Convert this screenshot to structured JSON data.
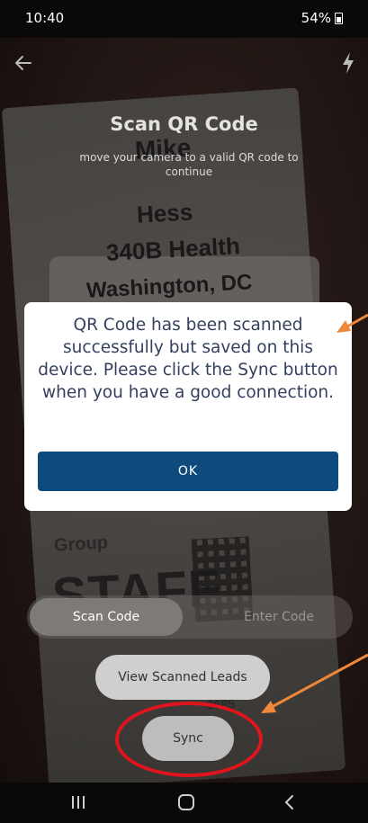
{
  "status_bar": {
    "time": "10:40",
    "battery": "54%"
  },
  "screen": {
    "title": "Scan QR Code",
    "subtitle": "move your camera to a valid QR code to continue"
  },
  "badge_photo": {
    "name": "Mike",
    "last_name": "Hess",
    "organization": "340B Health",
    "city": "Washington, DC",
    "group_label": "Group",
    "role": "STAFF",
    "code": "0685"
  },
  "dialog": {
    "message": "QR Code has been scanned successfully but saved on this device. Please click the Sync button when you have a good connection.",
    "ok_label": "OK"
  },
  "mode_toggle": {
    "scan_label": "Scan Code",
    "enter_label": "Enter Code",
    "selected": "Scan Code"
  },
  "buttons": {
    "view_leads": "View Scanned Leads",
    "sync": "Sync"
  },
  "colors": {
    "primary_button": "#0e4b7c",
    "annotation_arrow": "#f0883a",
    "annotation_circle": "#e0141c"
  },
  "icons": {
    "back": "arrow-left-icon",
    "flash": "flash-icon",
    "nav_recent": "recent-apps-icon",
    "nav_home": "home-icon",
    "nav_back": "nav-back-icon"
  }
}
